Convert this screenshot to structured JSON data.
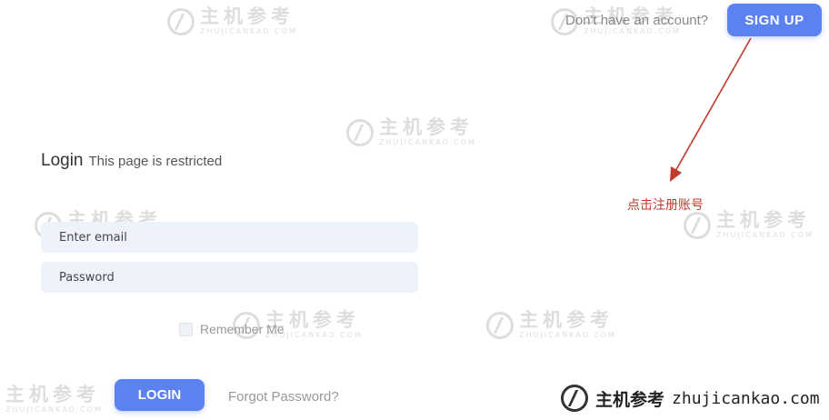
{
  "watermark": {
    "cn": "主机参考",
    "en": "ZHUJICANKAO.COM"
  },
  "header": {
    "prompt": "Don't have an account?",
    "signup_label": "SIGN UP"
  },
  "login": {
    "title": "Login",
    "subtitle": "This page is restricted",
    "email_placeholder": "Enter email",
    "password_placeholder": "Password",
    "remember_label": "Remember Me",
    "login_label": "LOGIN",
    "forgot_label": "Forgot Password?"
  },
  "annotation": {
    "text": "点击注册账号",
    "color": "#c0392b"
  },
  "brand": {
    "cn": "主机参考",
    "url": "zhujicankao.com"
  },
  "colors": {
    "accent": "#5b82f0",
    "input_bg": "#eef3fb"
  }
}
